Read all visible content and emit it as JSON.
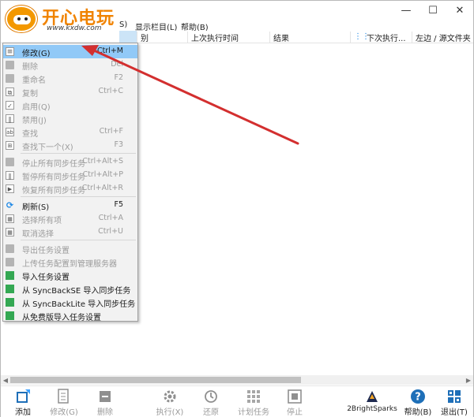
{
  "logo": {
    "text": "开心电玩",
    "url": "www.kxdw.com"
  },
  "window_controls": {
    "minimize": "—",
    "maximize": "☐",
    "close": "✕"
  },
  "menubar": {
    "items": [
      "S)",
      "显示栏目(L)",
      "帮助(B)"
    ]
  },
  "columns": [
    "别",
    "上次执行时间",
    "结果",
    "下次执行...",
    "左边 / 源文件夹"
  ],
  "context_menu": {
    "items": [
      {
        "label": "修改(G)",
        "shortcut": "Ctrl+M",
        "state": "highlight",
        "icon": "edit-icon"
      },
      {
        "label": "删除",
        "shortcut": "Del",
        "state": "disabled",
        "icon": "delete-icon"
      },
      {
        "label": "重命名",
        "shortcut": "F2",
        "state": "disabled",
        "icon": "rename-icon"
      },
      {
        "label": "复制",
        "shortcut": "Ctrl+C",
        "state": "disabled",
        "icon": "copy-icon"
      },
      {
        "label": "启用(Q)",
        "shortcut": "",
        "state": "disabled",
        "icon": "enable-icon"
      },
      {
        "label": "禁用(J)",
        "shortcut": "",
        "state": "disabled",
        "icon": "disable-icon"
      },
      {
        "label": "查找",
        "shortcut": "Ctrl+F",
        "state": "disabled",
        "icon": "find-icon"
      },
      {
        "label": "查找下一个(X)",
        "shortcut": "F3",
        "state": "disabled",
        "icon": "find-next-icon"
      },
      {
        "label": "停止所有同步任务",
        "shortcut": "Ctrl+Alt+S",
        "state": "disabled",
        "icon": "stop-all-icon"
      },
      {
        "label": "暂停所有同步任务",
        "shortcut": "Ctrl+Alt+P",
        "state": "disabled",
        "icon": "pause-all-icon"
      },
      {
        "label": "恢复所有同步任务",
        "shortcut": "Ctrl+Alt+R",
        "state": "disabled",
        "icon": "resume-all-icon"
      },
      {
        "label": "刷新(S)",
        "shortcut": "F5",
        "state": "enabled",
        "icon": "refresh-icon"
      },
      {
        "label": "选择所有项",
        "shortcut": "Ctrl+A",
        "state": "disabled",
        "icon": "select-all-icon"
      },
      {
        "label": "取消选择",
        "shortcut": "Ctrl+U",
        "state": "disabled",
        "icon": "deselect-icon"
      },
      {
        "label": "导出任务设置",
        "shortcut": "",
        "state": "disabled",
        "icon": "export-icon"
      },
      {
        "label": "上传任务配置到管理服务器",
        "shortcut": "",
        "state": "disabled",
        "icon": "upload-icon"
      },
      {
        "label": "导入任务设置",
        "shortcut": "",
        "state": "enabled",
        "icon": "import-icon"
      },
      {
        "label": "从 SyncBackSE 导入同步任务",
        "shortcut": "",
        "state": "enabled",
        "icon": "import-se-icon"
      },
      {
        "label": "从 SyncBackLite 导入同步任务",
        "shortcut": "",
        "state": "enabled",
        "icon": "import-lite-icon"
      },
      {
        "label": "从免费版导入任务设置",
        "shortcut": "",
        "state": "enabled",
        "icon": "import-free-icon"
      }
    ]
  },
  "toolbar": {
    "add": "添加",
    "modify": "修改(G)",
    "delete": "删除",
    "run": "执行(X)",
    "restore": "还原",
    "schedule": "计划任务",
    "stop": "停止",
    "brand": "2BrightSparks",
    "help": "帮助(B)",
    "exit": "退出(T)"
  },
  "colors": {
    "accent": "#1e88e5",
    "highlight": "#91c9f7",
    "arrow": "#d32f2f",
    "logo": "#f08300"
  }
}
